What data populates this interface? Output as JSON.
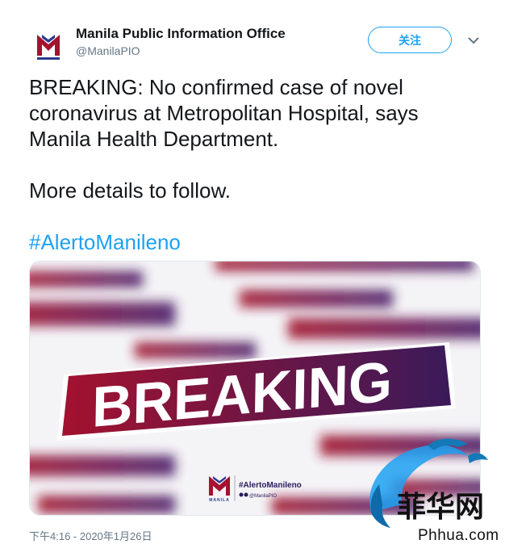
{
  "account": {
    "display_name": "Manila Public Information Office",
    "handle": "@ManilaPIO"
  },
  "actions": {
    "follow_label": "关注"
  },
  "tweet": {
    "text_line1": "BREAKING: No confirmed case of novel coronavirus at Metropolitan Hospital, says Manila Health Department.",
    "text_line2": "More details to follow.",
    "hashtag": "#AlertoManileno",
    "timestamp": "下午4:16 - 2020年1月26日"
  },
  "media": {
    "headline": "BREAKING",
    "footer_hashtag": "#AlertoManileno",
    "footer_social": "@ManilaPIO",
    "logo_caption": "MANILA"
  },
  "watermark": {
    "chinese": "菲华网",
    "domain": "Phhua.com"
  },
  "colors": {
    "accent": "#1da1f2",
    "brand_red": "#a3122f",
    "brand_purple": "#3b1a5a"
  }
}
